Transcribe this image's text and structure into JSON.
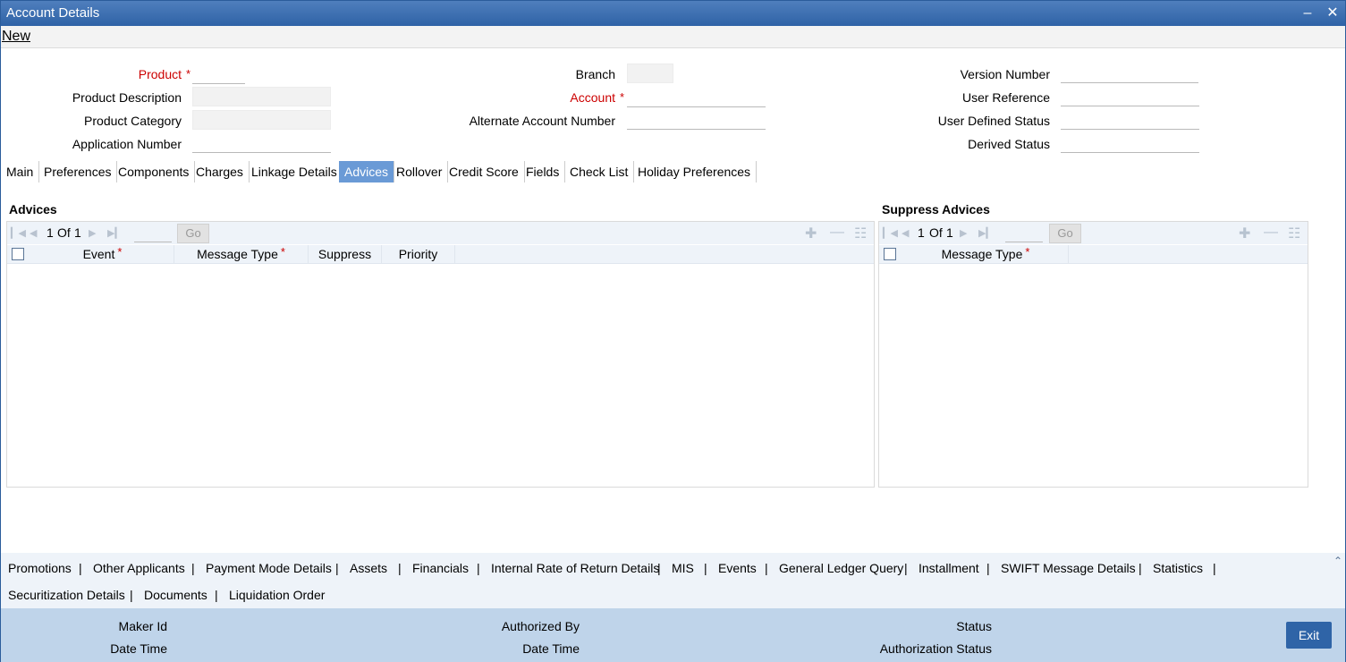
{
  "window": {
    "title": "Account Details",
    "minimize_icon": "minimize-icon",
    "close_icon": "close-icon"
  },
  "menu": {
    "new_label": "New"
  },
  "header_fields": {
    "product": "Product",
    "product_description": "Product Description",
    "product_category": "Product Category",
    "application_number": "Application Number",
    "branch": "Branch",
    "account": "Account",
    "alternate_account_number": "Alternate Account Number",
    "version_number": "Version Number",
    "user_reference": "User Reference",
    "user_defined_status": "User Defined Status",
    "derived_status": "Derived Status",
    "required_mark": "*"
  },
  "tabs": [
    "Main",
    "Preferences",
    "Components",
    "Charges",
    "Linkage Details",
    "Advices",
    "Rollover",
    "Credit Score",
    "Fields",
    "Check List",
    "Holiday Preferences"
  ],
  "active_tab": "Advices",
  "advices": {
    "title": "Advices",
    "page_current": "1",
    "page_of": "Of",
    "page_total": "1",
    "go_label": "Go",
    "columns": [
      "Event",
      "Message Type",
      "Suppress",
      "Priority"
    ]
  },
  "suppress_advices": {
    "title": "Suppress Advices",
    "page_current": "1",
    "page_of": "Of",
    "page_total": "1",
    "go_label": "Go",
    "columns": [
      "Message Type"
    ]
  },
  "bottom_links": {
    "row1": [
      "Promotions",
      "Other Applicants",
      "Payment Mode Details",
      "Assets",
      "Financials",
      "Internal Rate of Return Details",
      "MIS",
      "Events",
      "General Ledger Query",
      "Installment",
      "SWIFT Message Details",
      "Statistics"
    ],
    "row2": [
      "Securitization Details",
      "Documents",
      "Liquidation Order"
    ],
    "separator": "|"
  },
  "footer": {
    "maker_id": "Maker Id",
    "date_time_1": "Date Time",
    "authorized_by": "Authorized By",
    "date_time_2": "Date Time",
    "status": "Status",
    "authorization_status": "Authorization Status",
    "exit_label": "Exit"
  },
  "colors": {
    "titlebar": "#2f62a6",
    "active_tab": "#6a9ad6",
    "required": "#cc0000",
    "footer": "#bfd4ea",
    "exit_button": "#2f64a7"
  }
}
